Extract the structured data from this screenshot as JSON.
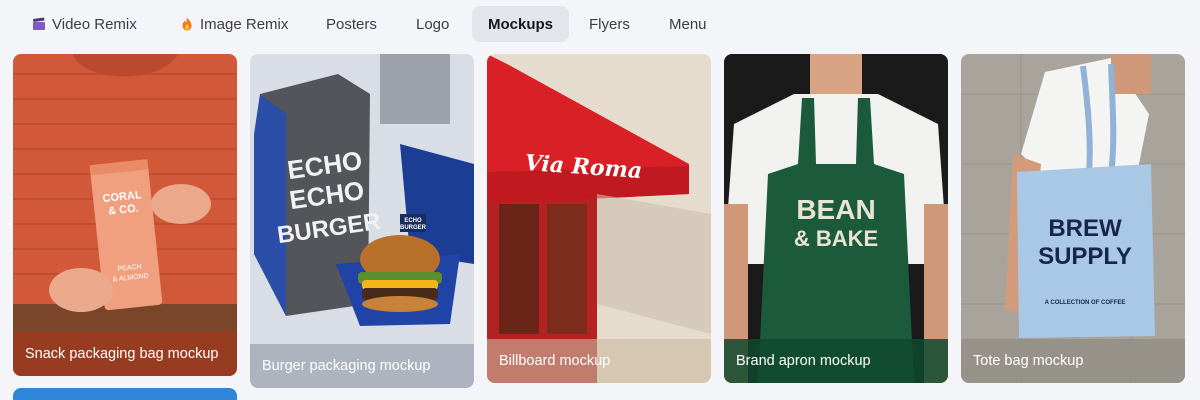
{
  "tabs": [
    {
      "label": "Video Remix",
      "icon": "video-clapper-icon",
      "active": false
    },
    {
      "label": "Image Remix",
      "icon": "fire-icon",
      "active": false
    },
    {
      "label": "Posters",
      "active": false
    },
    {
      "label": "Logo",
      "active": false
    },
    {
      "label": "Mockups",
      "active": true
    },
    {
      "label": "Flyers",
      "active": false
    },
    {
      "label": "Menu",
      "active": false
    }
  ],
  "cards": [
    {
      "caption": "Snack packaging bag mockup",
      "product_text": [
        "CORAL",
        "& CO.",
        "PEACH",
        "& ALMOND"
      ]
    },
    {
      "caption": "Burger packaging mockup",
      "product_text": [
        "ECHO",
        "ECHO",
        "BURGER"
      ],
      "flag_text": [
        "ECHO",
        "BURGER"
      ]
    },
    {
      "caption": "Billboard mockup",
      "product_text": [
        "Via Roma"
      ]
    },
    {
      "caption": "Brand apron mockup",
      "product_text": [
        "BEAN",
        "& BAKE"
      ]
    },
    {
      "caption": "Tote bag mockup",
      "product_text": [
        "BREW",
        "SUPPLY",
        "A COLLECTION OF COFFEE"
      ]
    }
  ],
  "colors": {
    "accent_active_tab": "#e3e5ea",
    "peek_card": "#2f86d9"
  }
}
